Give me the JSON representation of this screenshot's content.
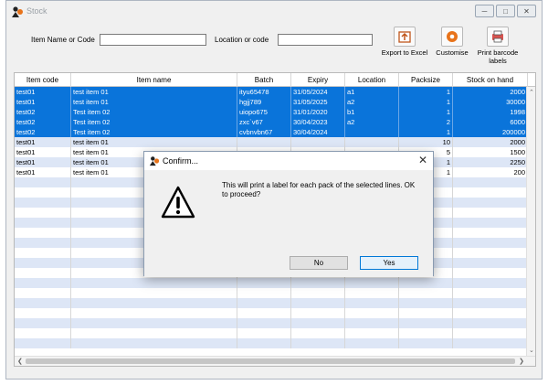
{
  "window": {
    "title": "Stock"
  },
  "filters": {
    "item_label": "Item Name or Code",
    "item_value": "",
    "location_label": "Location or code",
    "location_value": ""
  },
  "toolbar": {
    "export_label": "Export to Excel",
    "customise_label": "Customise",
    "print_label": "Print barcode labels"
  },
  "table": {
    "headers": [
      "Item code",
      "Item name",
      "Batch",
      "Expiry",
      "Location",
      "Packsize",
      "Stock on hand"
    ],
    "rows": [
      {
        "code": "test01",
        "name": "test item 01",
        "batch": "ityu65478",
        "expiry": "31/05/2024",
        "location": "a1",
        "packsize": "1",
        "stock": "2000",
        "selected": true
      },
      {
        "code": "test01",
        "name": "test item 01",
        "batch": "hgjj789",
        "expiry": "31/05/2025",
        "location": "a2",
        "packsize": "1",
        "stock": "30000",
        "selected": true
      },
      {
        "code": "test02",
        "name": "Test item 02",
        "batch": "uiopo675",
        "expiry": "31/01/2020",
        "location": "b1",
        "packsize": "1",
        "stock": "1998",
        "selected": true
      },
      {
        "code": "test02",
        "name": "Test item 02",
        "batch": "zxc`v67",
        "expiry": "30/04/2023",
        "location": "a2",
        "packsize": "2",
        "stock": "6000",
        "selected": true
      },
      {
        "code": "test02",
        "name": "Test item 02",
        "batch": "cvbnvbn67",
        "expiry": "30/04/2024",
        "location": "",
        "packsize": "1",
        "stock": "200000",
        "selected": true
      },
      {
        "code": "test01",
        "name": "test item 01",
        "batch": "",
        "expiry": "",
        "location": "",
        "packsize": "10",
        "stock": "2000",
        "selected": false
      },
      {
        "code": "test01",
        "name": "test item 01",
        "batch": "",
        "expiry": "",
        "location": "",
        "packsize": "5",
        "stock": "1500",
        "selected": false
      },
      {
        "code": "test01",
        "name": "test item 01",
        "batch": "",
        "expiry": "",
        "location": "",
        "packsize": "1",
        "stock": "2250",
        "selected": false
      },
      {
        "code": "test01",
        "name": "test item 01",
        "batch": "",
        "expiry": "",
        "location": "",
        "packsize": "1",
        "stock": "200",
        "selected": false
      }
    ],
    "empty_rows": 17
  },
  "dialog": {
    "title": "Confirm...",
    "message": "This will print a label for each pack of the selected lines. OK to proceed?",
    "no_label": "No",
    "yes_label": "Yes",
    "icon": "warning-icon"
  },
  "colors": {
    "selection": "#0a74da",
    "stripe": "#dde6f6",
    "accent": "#0078d7"
  }
}
